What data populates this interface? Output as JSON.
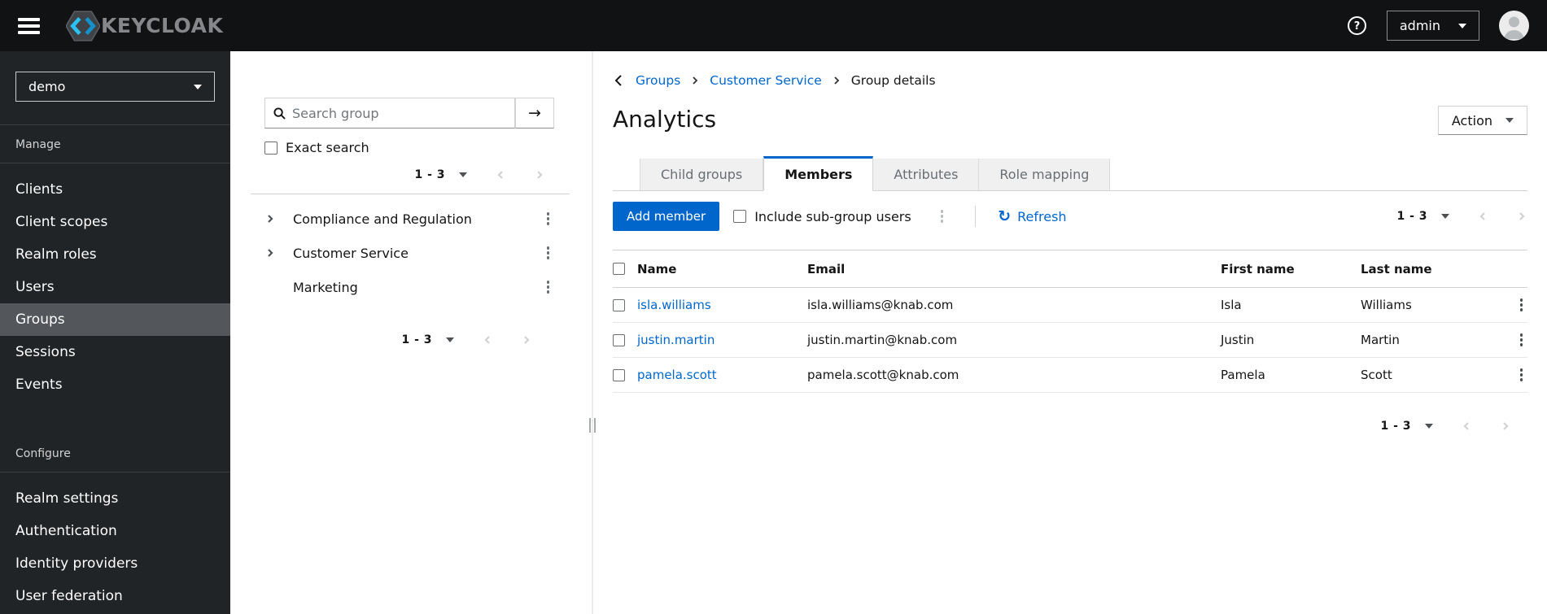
{
  "masthead": {
    "brand": "KEYCLOAK",
    "username": "admin"
  },
  "sidebar": {
    "realm": "demo",
    "manage_label": "Manage",
    "configure_label": "Configure",
    "manage_items": [
      "Clients",
      "Client scopes",
      "Realm roles",
      "Users",
      "Groups",
      "Sessions",
      "Events"
    ],
    "configure_items": [
      "Realm settings",
      "Authentication",
      "Identity providers",
      "User federation"
    ],
    "active_item": "Groups"
  },
  "tree_panel": {
    "search_placeholder": "Search group",
    "exact_search_label": "Exact search",
    "pagination_top": "1 - 3",
    "pagination_bottom": "1 - 3",
    "groups": [
      {
        "label": "Compliance and Regulation",
        "expandable": true
      },
      {
        "label": "Customer Service",
        "expandable": true
      },
      {
        "label": "Marketing",
        "expandable": false
      }
    ]
  },
  "main": {
    "breadcrumb": {
      "items": [
        "Groups",
        "Customer Service"
      ],
      "current": "Group details"
    },
    "title": "Analytics",
    "action_label": "Action",
    "tabs": [
      "Child groups",
      "Members",
      "Attributes",
      "Role mapping"
    ],
    "active_tab": "Members",
    "toolbar": {
      "add_member": "Add member",
      "include_subgroups": "Include sub-group users",
      "refresh": "Refresh",
      "pagination": "1 - 3"
    },
    "table": {
      "columns": [
        "Name",
        "Email",
        "First name",
        "Last name"
      ],
      "rows": [
        {
          "name": "isla.williams",
          "email": "isla.williams@knab.com",
          "first_name": "Isla",
          "last_name": "Williams"
        },
        {
          "name": "justin.martin",
          "email": "justin.martin@knab.com",
          "first_name": "Justin",
          "last_name": "Martin"
        },
        {
          "name": "pamela.scott",
          "email": "pamela.scott@knab.com",
          "first_name": "Pamela",
          "last_name": "Scott"
        }
      ]
    },
    "pagination_bottom": "1 - 3"
  },
  "icons": {
    "refresh_glyph": "↻",
    "search_submit_glyph": "→"
  },
  "colors": {
    "primary": "#0066cc",
    "link": "#0066cc",
    "masthead_bg": "#101214",
    "sidebar_bg": "#212427",
    "active_nav_bg": "#53565a",
    "tab_inactive_bg": "#f0f0f0",
    "border": "#d2d2d2"
  }
}
